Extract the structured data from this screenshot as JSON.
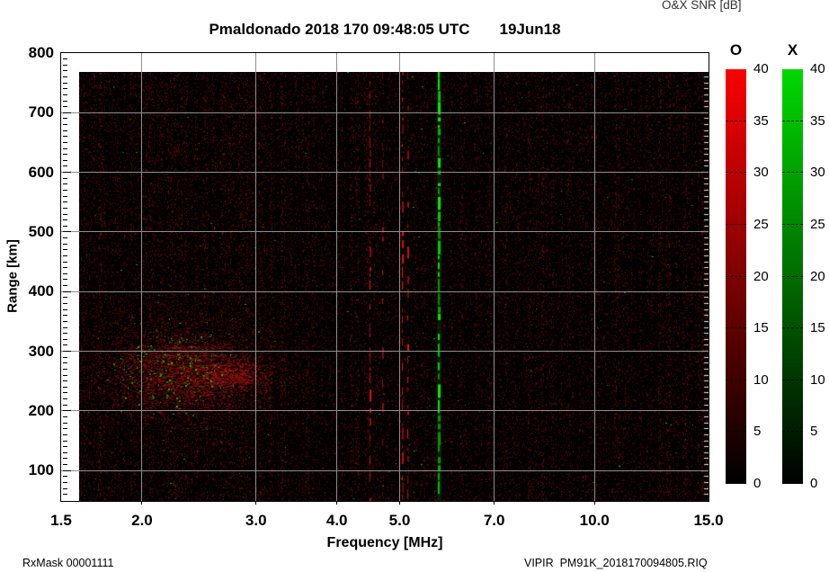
{
  "header": {
    "title": "Pmaldonado 2018 170 09:48:05 UTC",
    "date": "19Jun18",
    "colorbar_title": "O&X SNR [dB]"
  },
  "footer": {
    "rx_mask": "RxMask 00001111",
    "file_label": "VIPIR  PM91K_2018170094805.RIQ"
  },
  "chart_data": {
    "type": "heatmap",
    "subtype": "ionogram",
    "title": "Pmaldonado 2018 170 09:48:05 UTC",
    "date_label": "19Jun18",
    "xlabel": "Frequency [MHz]",
    "ylabel": "Range [km]",
    "x_scale": "log",
    "xlim": [
      1.5,
      15.0
    ],
    "ylim": [
      49,
      800
    ],
    "x_ticks": [
      2.0,
      3.0,
      4.0,
      5.0,
      7.0,
      10.0
    ],
    "x_tick_labels": [
      {
        "value": 1.5,
        "label": "1.5"
      },
      {
        "value": 2.0,
        "label": "2.0"
      },
      {
        "value": 3.0,
        "label": "3.0"
      },
      {
        "value": 4.0,
        "label": "4.0"
      },
      {
        "value": 5.0,
        "label": "5.0"
      },
      {
        "value": 7.0,
        "label": "7.0"
      },
      {
        "value": 10.0,
        "label": "10.0"
      },
      {
        "value": 15.0,
        "label": "15.0"
      }
    ],
    "y_ticks": [
      100,
      200,
      300,
      400,
      500,
      600,
      700,
      800
    ],
    "y_minor_tick_step_km": 10,
    "grid": true,
    "grid_color": "#8e8e8e",
    "background": "#000000",
    "data_extent": {
      "freq_mhz": [
        1.6,
        15.0
      ],
      "range_km": [
        49,
        768
      ]
    },
    "colorbars": [
      {
        "label": "O",
        "color": "#fa0000",
        "min": 0,
        "max": 40,
        "ticks": [
          0,
          5,
          10,
          15,
          20,
          25,
          30,
          35,
          40
        ]
      },
      {
        "label": "X",
        "color": "#00d800",
        "min": 0,
        "max": 40,
        "ticks": [
          0,
          5,
          10,
          15,
          20,
          25,
          30,
          35,
          40
        ]
      }
    ],
    "features": {
      "noise": {
        "description": "faint dark-red speckle columns over black; sparse green dots; denser left of 3 MHz",
        "enhanced_red_columns_mhz": [
          1.72,
          2.9,
          3.28,
          3.6,
          4.2,
          6.2,
          6.9,
          8.3,
          9.1,
          10.8,
          12.6,
          13.8,
          14.5
        ],
        "green_dot_zone_mhz": [
          5.0,
          5.9
        ]
      },
      "echo_patch": {
        "freq_mhz": [
          1.9,
          3.0
        ],
        "range_km": [
          210,
          330
        ],
        "core_freq_mhz": [
          2.0,
          2.6
        ],
        "core_range_km": [
          230,
          300
        ],
        "green_cluster_freq_mhz": [
          2.0,
          2.5
        ],
        "green_cluster_range_km": [
          240,
          300
        ],
        "description": "diffuse red spread echo with embedded bright-green speckle cluster"
      },
      "rfi_lines": [
        {
          "freq_mhz": 4.5,
          "color": "red",
          "strength": 0.45
        },
        {
          "freq_mhz": 4.72,
          "color": "red",
          "strength": 0.22
        },
        {
          "freq_mhz": 5.05,
          "color": "red",
          "strength": 0.6
        },
        {
          "freq_mhz": 5.15,
          "color": "red",
          "strength": 0.42
        },
        {
          "freq_mhz": 5.75,
          "color": "green",
          "strength": 0.75
        }
      ]
    }
  }
}
